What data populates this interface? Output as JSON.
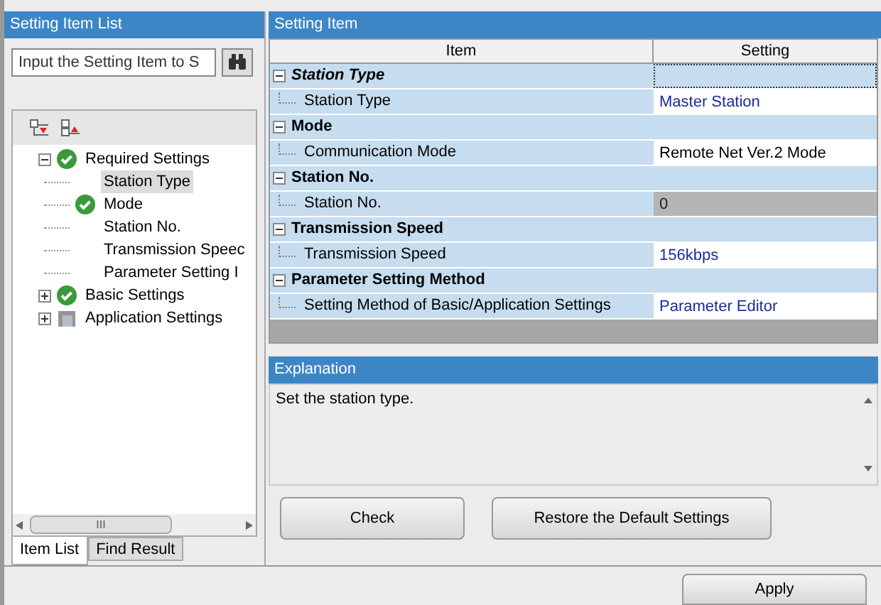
{
  "left_panel": {
    "title": "Setting Item List",
    "search": {
      "placeholder": "Input the Setting Item to S"
    },
    "tree": [
      {
        "label": "Required Settings",
        "checked": true,
        "expanded": true,
        "selected": false,
        "children": [
          {
            "label": "Station Type",
            "selected": true
          },
          {
            "label": "Mode",
            "checked": true,
            "selected": false
          },
          {
            "label": "Station No.",
            "selected": false
          },
          {
            "label": "Transmission Speec",
            "selected": false
          },
          {
            "label": "Parameter Setting I",
            "selected": false
          }
        ]
      },
      {
        "label": "Basic Settings",
        "checked": true,
        "expanded": false,
        "selected": false
      },
      {
        "label": "Application Settings",
        "checked": false,
        "expanded": false,
        "selected": false
      }
    ],
    "scrollbar_grip": "III",
    "tabs": [
      {
        "label": "Item List",
        "selected": true
      },
      {
        "label": "Find Result",
        "selected": false
      }
    ]
  },
  "setting_panel": {
    "title": "Setting Item",
    "columns": [
      "Item",
      "Setting"
    ],
    "groups": [
      {
        "title": "Station Type",
        "selected": true,
        "rows": [
          {
            "item": "Station Type",
            "setting": "Master Station",
            "kind": "choice"
          }
        ]
      },
      {
        "title": "Mode",
        "selected": false,
        "rows": [
          {
            "item": "Communication Mode",
            "setting": "Remote Net Ver.2 Mode",
            "kind": "text"
          }
        ]
      },
      {
        "title": "Station No.",
        "selected": false,
        "rows": [
          {
            "item": "Station No.",
            "setting": "0",
            "kind": "disabled"
          }
        ]
      },
      {
        "title": "Transmission Speed",
        "selected": false,
        "rows": [
          {
            "item": "Transmission Speed",
            "setting": "156kbps",
            "kind": "choice"
          }
        ]
      },
      {
        "title": "Parameter Setting Method",
        "selected": false,
        "rows": [
          {
            "item": "Setting Method of Basic/Application Settings",
            "setting": "Parameter Editor",
            "kind": "choice"
          }
        ]
      }
    ]
  },
  "explanation": {
    "title": "Explanation",
    "text": "Set the station type."
  },
  "buttons": [
    "Check",
    "Restore the Default Settings"
  ],
  "apply_button": "Apply"
}
